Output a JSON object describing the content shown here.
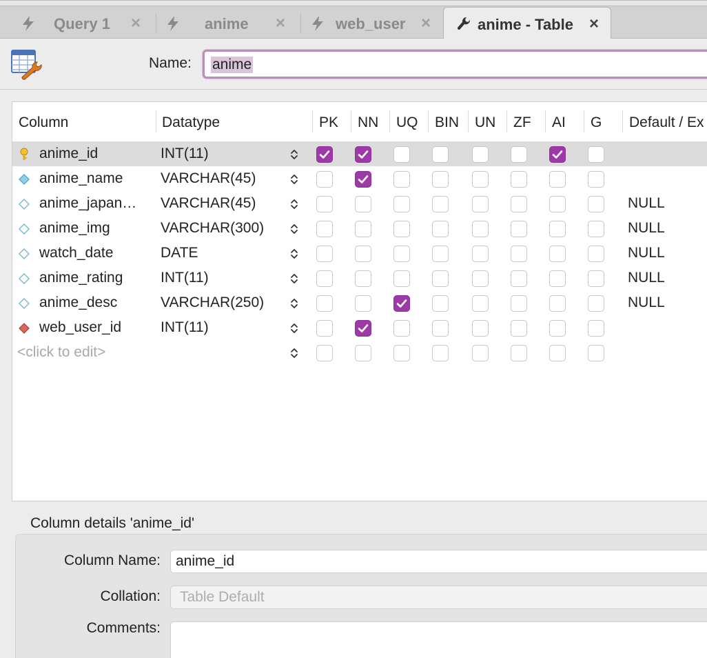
{
  "tabs": [
    {
      "label": "Query 1",
      "icon": "lightning-icon",
      "close": "×",
      "active": false
    },
    {
      "label": "anime",
      "icon": "lightning-icon",
      "close": "×",
      "active": false
    },
    {
      "label": "web_user",
      "icon": "lightning-icon",
      "close": "×",
      "active": false
    },
    {
      "label": "anime - Table",
      "icon": "wrench-icon",
      "close": "×",
      "active": true
    }
  ],
  "name_row": {
    "label": "Name:",
    "value": "anime"
  },
  "grid": {
    "headers": {
      "column": "Column",
      "datatype": "Datatype",
      "pk": "PK",
      "nn": "NN",
      "uq": "UQ",
      "bin": "BIN",
      "un": "UN",
      "zf": "ZF",
      "ai": "AI",
      "g": "G",
      "default": "Default / Ex"
    },
    "rows": [
      {
        "name": "anime_id",
        "type": "INT(11)",
        "key": "primary-key-icon",
        "flags": [
          1,
          1,
          0,
          0,
          0,
          0,
          1,
          0
        ],
        "default": "",
        "selected": true
      },
      {
        "name": "anime_name",
        "type": "VARCHAR(45)",
        "key": "column-diamond-icon",
        "flags": [
          0,
          1,
          0,
          0,
          0,
          0,
          0,
          0
        ],
        "default": ""
      },
      {
        "name": "anime_japan…",
        "type": "VARCHAR(45)",
        "key": "column-outline-icon",
        "flags": [
          0,
          0,
          0,
          0,
          0,
          0,
          0,
          0
        ],
        "default": "NULL"
      },
      {
        "name": "anime_img",
        "type": "VARCHAR(300)",
        "key": "column-outline-icon",
        "flags": [
          0,
          0,
          0,
          0,
          0,
          0,
          0,
          0
        ],
        "default": "NULL"
      },
      {
        "name": "watch_date",
        "type": "DATE",
        "key": "column-outline-icon",
        "flags": [
          0,
          0,
          0,
          0,
          0,
          0,
          0,
          0
        ],
        "default": "NULL"
      },
      {
        "name": "anime_rating",
        "type": "INT(11)",
        "key": "column-outline-icon",
        "flags": [
          0,
          0,
          0,
          0,
          0,
          0,
          0,
          0
        ],
        "default": "NULL"
      },
      {
        "name": "anime_desc",
        "type": "VARCHAR(250)",
        "key": "column-outline-icon",
        "flags": [
          0,
          0,
          1,
          0,
          0,
          0,
          0,
          0
        ],
        "default": "NULL"
      },
      {
        "name": "web_user_id",
        "type": "INT(11)",
        "key": "foreign-key-icon",
        "flags": [
          0,
          1,
          0,
          0,
          0,
          0,
          0,
          0
        ],
        "default": ""
      }
    ],
    "new_row_placeholder": "<click to edit>"
  },
  "details": {
    "title": "Column details 'anime_id'",
    "column_name_label": "Column Name:",
    "column_name_value": "anime_id",
    "collation_label": "Collation:",
    "collation_value": "Table Default",
    "comments_label": "Comments:",
    "comments_value": ""
  },
  "colors": {
    "checkbox_on": "#9d3aa8",
    "focus_ring": "#b990b8",
    "selected_row": "#dcdcdc"
  }
}
